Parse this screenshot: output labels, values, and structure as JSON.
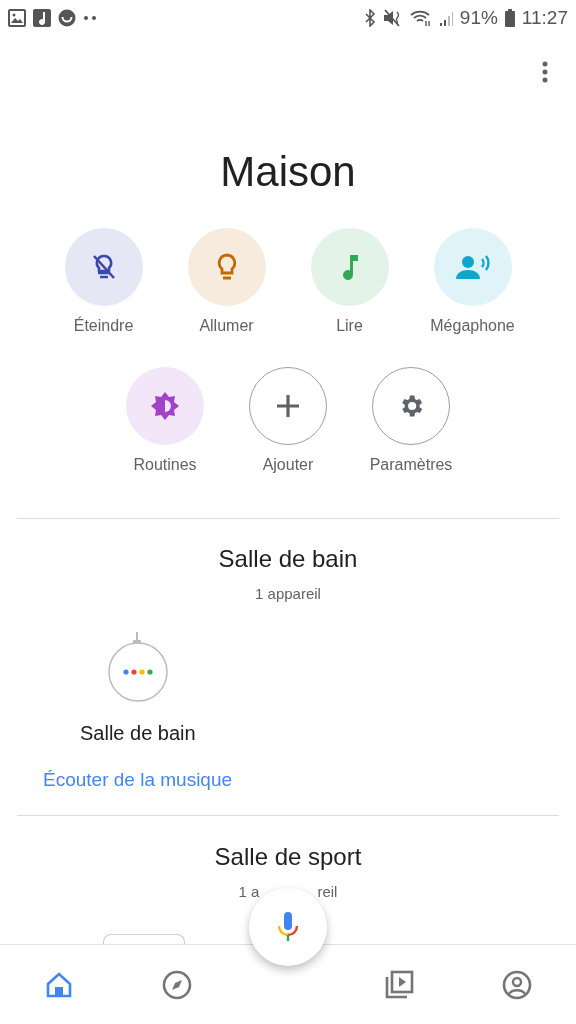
{
  "status_bar": {
    "battery": "91%",
    "time": "11:27"
  },
  "title": "Maison",
  "actions": [
    {
      "kind": "lights_off",
      "label": "Éteindre",
      "color": "#3949ab"
    },
    {
      "kind": "lights_on",
      "label": "Allumer",
      "color": "#c26a00"
    },
    {
      "kind": "play",
      "label": "Lire",
      "color": "#34a853"
    },
    {
      "kind": "broadcast",
      "label": "Mégaphone",
      "color": "#12a4c9"
    },
    {
      "kind": "routines",
      "label": "Routines",
      "color": "#a142c7"
    },
    {
      "kind": "add",
      "label": "Ajouter",
      "color": "#5f6368"
    },
    {
      "kind": "settings",
      "label": "Paramètres",
      "color": "#5f6368"
    }
  ],
  "rooms": [
    {
      "name": "Salle de bain",
      "count": "1 appareil",
      "devices": [
        {
          "name": "Salle de bain"
        }
      ],
      "link": "Écouter de la musique"
    },
    {
      "name": "Salle de sport",
      "count_parts": [
        "1 a",
        "reil"
      ]
    }
  ],
  "nav": [
    {
      "kind": "home",
      "selected": true
    },
    {
      "kind": "explore",
      "selected": false
    },
    {
      "kind": "media",
      "selected": false
    },
    {
      "kind": "account",
      "selected": false
    }
  ]
}
